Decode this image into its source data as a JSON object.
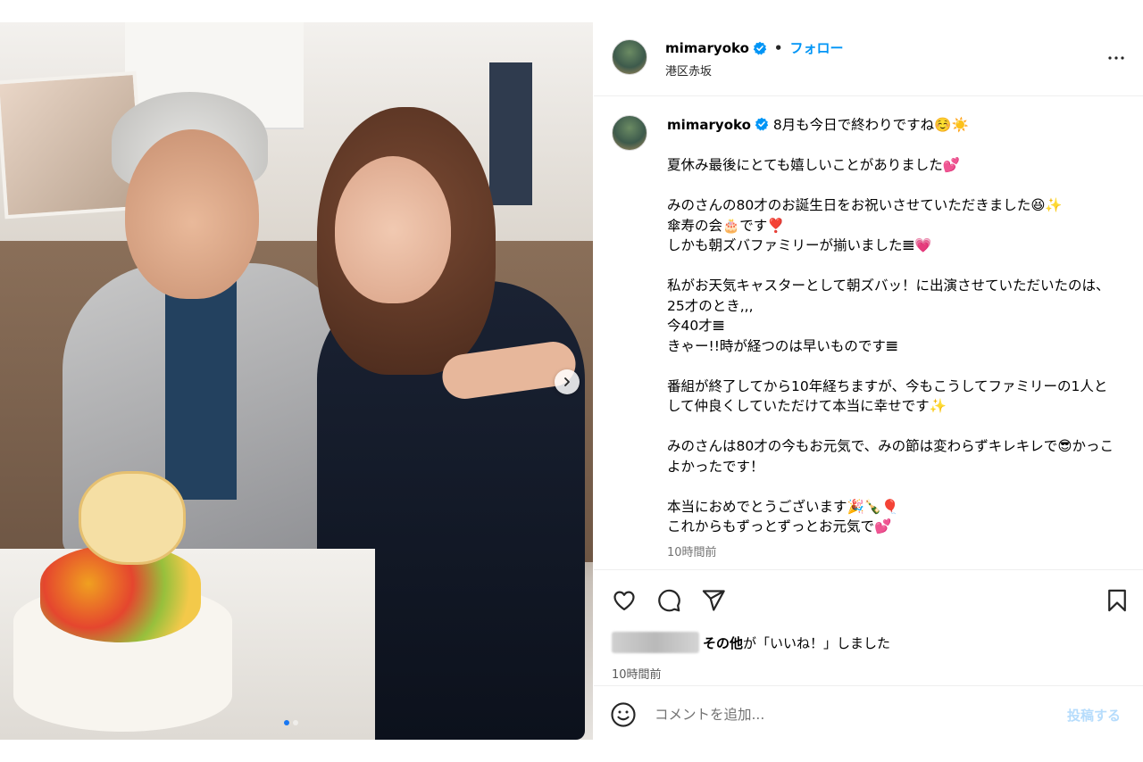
{
  "post": {
    "username": "mimaryoko",
    "separator": "•",
    "follow_label": "フォロー",
    "location": "港区赤坂",
    "caption_username": "mimaryoko",
    "caption_text": " 8月も今日で終わりですね☺️☀️\n\n夏休み最後にとても嬉しいことがありました💕\n\nみのさんの80才のお誕生日をお祝いさせていただきました😆✨\n傘寿の会🎂です❣️\nしかも朝ズバファミリーが揃いました𝌆💗\n\n私がお天気キャスターとして朝ズバッ！に出演させていただいたのは、25才のとき,,,\n今40才𝌆\nきゃー!!時が経つのは早いものです𝌆\n\n番組が終了してから10年経ちますが、今もこうしてファミリーの1人として仲良くしていただけて本当に幸せです✨\n\nみのさんは80才の今もお元気で、みの節は変わらずキレキレで😎かっこよかったです！\n\n本当におめでとうございます🎉🍾🎈\nこれからもずっとずっとお元気で💕",
    "caption_time": "10時間前",
    "likes_suffix_bold": "その他",
    "likes_suffix": "が「いいね！」しました",
    "post_time": "10時間前",
    "comment_placeholder": "コメントを追加...",
    "post_button": "投稿する"
  },
  "carousel": {
    "total": 2,
    "current": 1
  },
  "icons": {
    "verified": "verified-badge-icon",
    "more": "more-options-icon",
    "like": "heart-icon",
    "comment": "comment-bubble-icon",
    "share": "paper-plane-icon",
    "save": "bookmark-icon",
    "emoji": "emoji-smile-icon",
    "next": "chevron-right-icon"
  },
  "colors": {
    "accent": "#0095f6",
    "verified": "#0095f6",
    "post_button_disabled": "#b6dcfc",
    "carousel_active_dot": "#1877f2"
  }
}
